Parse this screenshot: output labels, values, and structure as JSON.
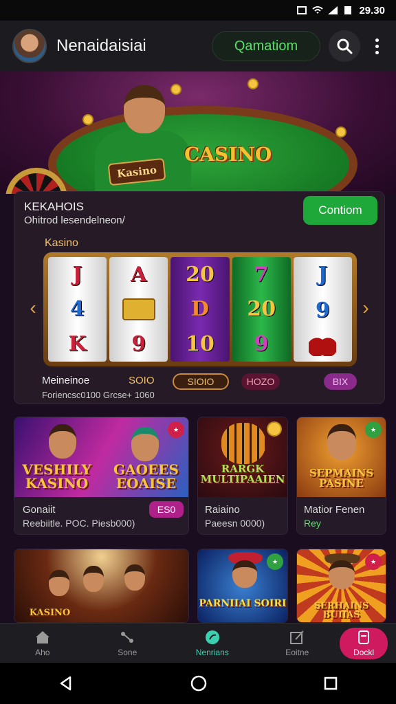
{
  "status_bar": {
    "time": "29.30"
  },
  "app_bar": {
    "title": "Nenaidaisiai",
    "pill_button": "Qamatiom"
  },
  "hero": {
    "sign_text": "Kasino",
    "logo_text": "CASINO"
  },
  "promo": {
    "title": "KEKAHOIS",
    "subtitle": "Ohitrod lesendelneon/",
    "button": "Contiom",
    "slot_label": "Kasino",
    "reels": [
      [
        "J",
        "4",
        "K"
      ],
      [
        "A",
        "",
        "9"
      ],
      [
        "20",
        "D",
        "10"
      ],
      [
        "7",
        "20",
        "9"
      ],
      [
        "J",
        "9",
        ""
      ]
    ],
    "stat_label": "Meineinoe",
    "stat_sub": "Foriencsc0100   Grcse+ 1060",
    "stat_mid": "SOIO",
    "chip1": "SIOIO",
    "chip2": "HOZO",
    "chip3": "BIX"
  },
  "games": [
    {
      "title_art": "VESHILY KASINO",
      "title_art2": "GAOEES EOAISE",
      "name": "Gonaiit",
      "meta": "Reebiitle. POC. Piesb000)",
      "price": "ES0"
    },
    {
      "title_art": "RARGK MULTIPAAIEN",
      "name": "Raiaino",
      "meta": "Paeesn 0000)"
    },
    {
      "title_art": "SEPMAINS PASINE",
      "name": "Matior Fenen",
      "meta": "Rey"
    },
    {
      "title_art": "KASINO"
    },
    {
      "title_art": "PARNIIAI SOIRI"
    },
    {
      "title_art": "SERHAINS BUIIAS"
    }
  ],
  "bottom_nav": {
    "items": [
      {
        "label": "Aho",
        "icon": "home-icon"
      },
      {
        "label": "Sone",
        "icon": "share-icon"
      },
      {
        "label": "Nenrians",
        "icon": "compass-icon"
      },
      {
        "label": "Eoitne",
        "icon": "edit-icon"
      },
      {
        "label": "Dockl",
        "icon": "wallet-icon"
      }
    ]
  },
  "colors": {
    "accent_green": "#1fa83a",
    "accent_pink": "#d01a60",
    "accent_teal": "#3ad0b0"
  }
}
